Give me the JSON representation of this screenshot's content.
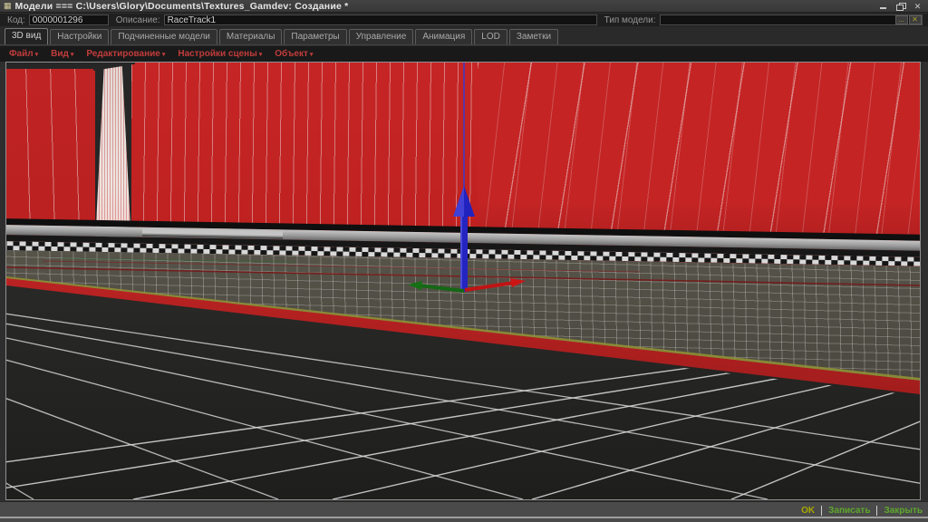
{
  "window": {
    "title": "Модели === C:\\Users\\Glory\\Documents\\Textures_Gamdev: Создание *"
  },
  "icons": {
    "app": "▦",
    "close": "✕",
    "caret": "▾",
    "dots": "...",
    "clear": "✕"
  },
  "header_form": {
    "code": {
      "label": "Код:",
      "value": "0000001296"
    },
    "description": {
      "label": "Описание:",
      "value": "RaceTrack1"
    },
    "model_type": {
      "label": "Тип модели:",
      "value": ""
    }
  },
  "tabs": [
    {
      "label": "3D вид",
      "active": true
    },
    {
      "label": "Настройки",
      "active": false
    },
    {
      "label": "Подчиненные модели",
      "active": false
    },
    {
      "label": "Материалы",
      "active": false
    },
    {
      "label": "Параметры",
      "active": false
    },
    {
      "label": "Управление",
      "active": false
    },
    {
      "label": "Анимация",
      "active": false
    },
    {
      "label": "LOD",
      "active": false
    },
    {
      "label": "Заметки",
      "active": false
    }
  ],
  "viewport_menu": {
    "items": [
      "Файл",
      "Вид",
      "Редактирование",
      "Настройки сцены",
      "Объект"
    ]
  },
  "scene": {
    "description": "3D racetrack editor view: red textured walls, guardrail, checkered curb, grid floor",
    "wall_color": "#c32424",
    "axis_colors": {
      "x": "#cc1616",
      "y": "#157015",
      "z": "#2424c4"
    }
  },
  "footer": {
    "ok": "OK",
    "save": "Записать",
    "close": "Закрыть",
    "separator": "|"
  }
}
